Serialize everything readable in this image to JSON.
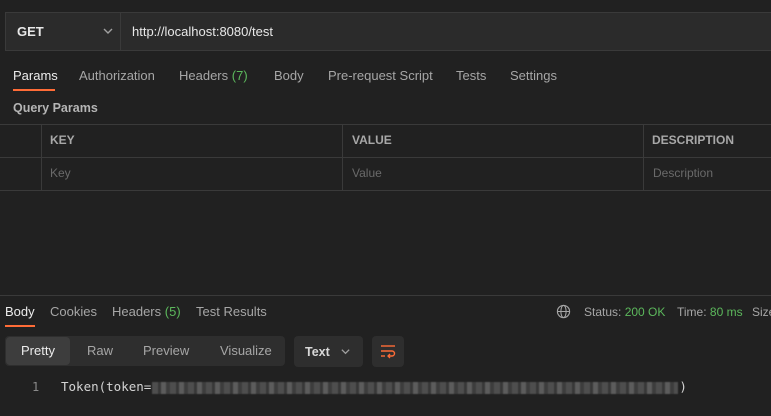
{
  "request": {
    "method": "GET",
    "url": "http://localhost:8080/test"
  },
  "request_tabs": [
    {
      "label": "Params"
    },
    {
      "label": "Authorization"
    },
    {
      "label": "Headers",
      "count": "(7)"
    },
    {
      "label": "Body"
    },
    {
      "label": "Pre-request Script"
    },
    {
      "label": "Tests"
    },
    {
      "label": "Settings"
    }
  ],
  "query_params": {
    "title": "Query Params",
    "headers": [
      "KEY",
      "VALUE",
      "DESCRIPTION"
    ],
    "placeholders": [
      "Key",
      "Value",
      "Description"
    ]
  },
  "response_tabs": [
    {
      "label": "Body"
    },
    {
      "label": "Cookies"
    },
    {
      "label": "Headers",
      "count": "(5)"
    },
    {
      "label": "Test Results"
    }
  ],
  "response_status": {
    "status_label": "Status:",
    "status_value": "200 OK",
    "time_label": "Time:",
    "time_value": "80 ms",
    "size_label": "Size"
  },
  "view_modes": [
    "Pretty",
    "Raw",
    "Preview",
    "Visualize"
  ],
  "format": "Text",
  "code": {
    "line_number": "1",
    "prefix": "Token(token=",
    "suffix": ")"
  },
  "colors": {
    "accent": "#ff6c37",
    "status_ok": "#5cb85c",
    "background": "#212121"
  }
}
